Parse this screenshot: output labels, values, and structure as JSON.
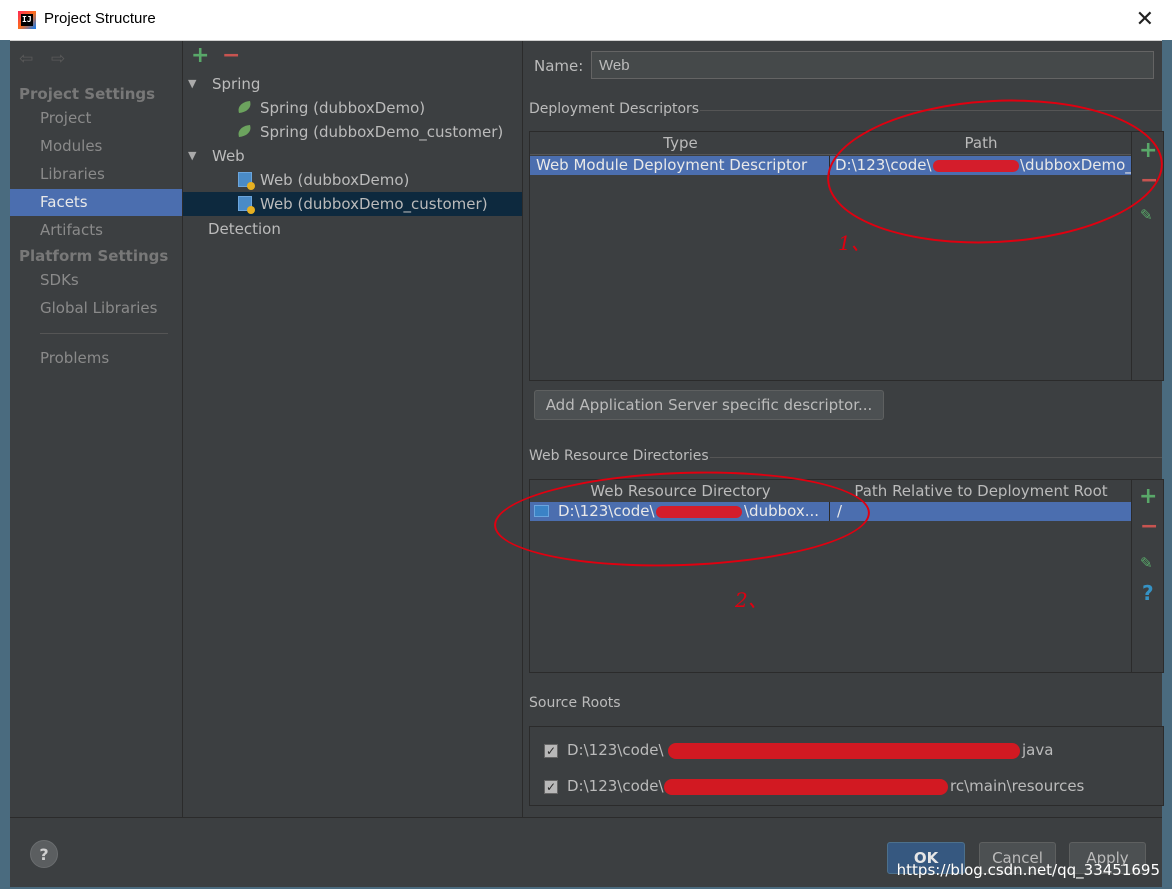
{
  "window": {
    "title": "Project Structure"
  },
  "leftnav": {
    "project_settings_heading": "Project Settings",
    "items_top": [
      "Project",
      "Modules",
      "Libraries",
      "Facets",
      "Artifacts"
    ],
    "platform_settings_heading": "Platform Settings",
    "items_platform": [
      "SDKs",
      "Global Libraries"
    ],
    "problems": "Problems",
    "selected": "Facets"
  },
  "tree": {
    "add_glyph": "+",
    "remove_glyph": "−",
    "groups": [
      {
        "label": "Spring",
        "children": [
          "Spring (dubboxDemo)",
          "Spring (dubboxDemo_customer)"
        ]
      },
      {
        "label": "Web",
        "children": [
          "Web (dubboxDemo)",
          "Web (dubboxDemo_customer)"
        ]
      }
    ],
    "detection": "Detection",
    "selected_child": "Web (dubboxDemo_customer)"
  },
  "facet": {
    "name_label": "Name:",
    "name_value": "Web",
    "deployment_descriptors_heading": "Deployment Descriptors",
    "dd_columns": [
      "Type",
      "Path"
    ],
    "dd_row": {
      "type": "Web Module Deployment Descriptor",
      "path_start": "D:\\123\\code\\",
      "path_end": "\\dubboxDemo_"
    },
    "add_descriptor_button": "Add Application Server specific descriptor...",
    "web_resource_heading": "Web Resource Directories",
    "wr_columns": [
      "Web Resource Directory",
      "Path Relative to Deployment Root"
    ],
    "wr_row": {
      "dir_start": "D:\\123\\code\\",
      "dir_end": "\\dubbox...",
      "relative": "/"
    },
    "source_roots_heading": "Source Roots",
    "source_roots": [
      {
        "start": "D:\\123\\code\\",
        "end": "java",
        "checked": true
      },
      {
        "start": "D:\\123\\code\\",
        "end": "rc\\main\\resources",
        "checked": true
      }
    ]
  },
  "annotations": {
    "one": "1、",
    "two": "2、"
  },
  "buttons": {
    "ok": "OK",
    "cancel": "Cancel",
    "apply": "Apply"
  },
  "help_glyph": "?",
  "watermark": "https://blog.csdn.net/qq_33451695",
  "colors": {
    "selection": "#4b6eaf",
    "background": "#3c3f41",
    "annotation_red": "#e00010"
  }
}
